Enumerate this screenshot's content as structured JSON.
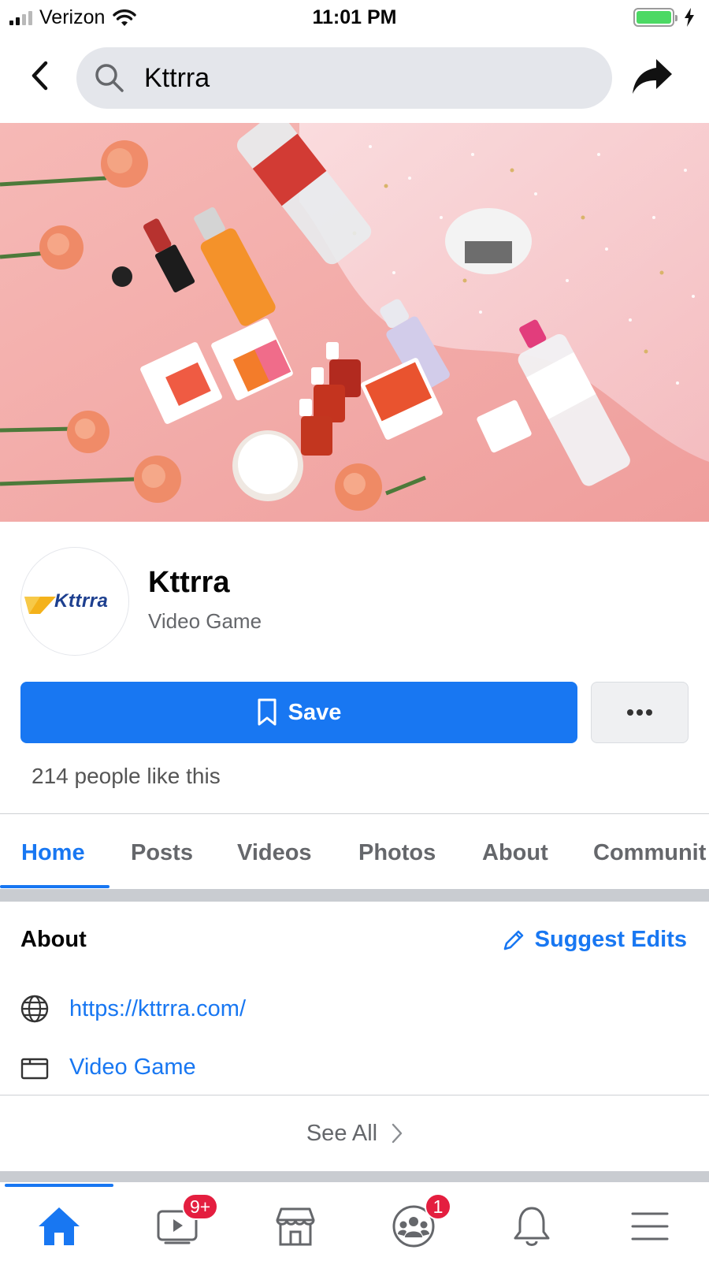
{
  "status_bar": {
    "carrier": "Verizon",
    "time": "11:01 PM",
    "battery_level": 1.0
  },
  "search": {
    "query": "Kttrra"
  },
  "page": {
    "name": "Kttrra",
    "category": "Video Game",
    "logo_text": "Kttrra",
    "save_label": "Save",
    "likes_text": "214 people like this"
  },
  "tabs": [
    {
      "label": "Home",
      "active": true
    },
    {
      "label": "Posts",
      "active": false
    },
    {
      "label": "Videos",
      "active": false
    },
    {
      "label": "Photos",
      "active": false
    },
    {
      "label": "About",
      "active": false
    },
    {
      "label": "Communit",
      "active": false
    }
  ],
  "about": {
    "title": "About",
    "suggest_edits_label": "Suggest Edits",
    "website": "https://kttrra.com/",
    "category": "Video Game",
    "see_all_label": "See All"
  },
  "bottom_nav": {
    "items": [
      {
        "name": "home-icon",
        "active": true,
        "badge": ""
      },
      {
        "name": "watch-icon",
        "active": false,
        "badge": "9+"
      },
      {
        "name": "marketplace-icon",
        "active": false,
        "badge": ""
      },
      {
        "name": "groups-icon",
        "active": false,
        "badge": "1"
      },
      {
        "name": "bell-icon",
        "active": false,
        "badge": ""
      },
      {
        "name": "menu-icon",
        "active": false,
        "badge": ""
      }
    ]
  },
  "colors": {
    "accent": "#1877f2",
    "badge": "#e41e3f",
    "cover_background": "#f2b2b1"
  }
}
